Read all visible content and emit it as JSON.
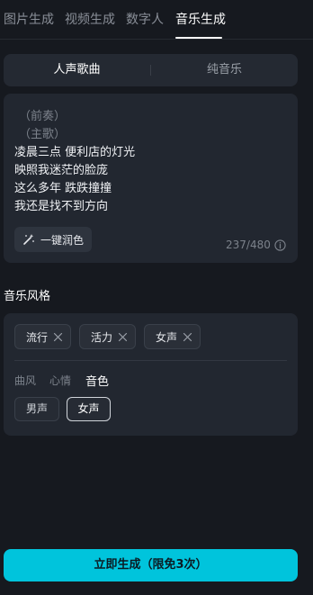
{
  "top_tabs": [
    {
      "label": "图片生成"
    },
    {
      "label": "视频生成"
    },
    {
      "label": "数字人"
    },
    {
      "label": "音乐生成",
      "active": true
    }
  ],
  "mode": {
    "vocal_label": "人声歌曲",
    "instrumental_label": "纯音乐",
    "selected": "人声歌曲"
  },
  "lyrics": {
    "lines": [
      "（前奏）",
      "（主歌）",
      "凌晨三点 便利店的灯光",
      "映照我迷茫的脸庞",
      "这么多年 跌跌撞撞",
      "我还是找不到方向"
    ],
    "polish_label": "一键润色",
    "counter": "237/480"
  },
  "style": {
    "title": "音乐风格",
    "chips": [
      {
        "label": "流行"
      },
      {
        "label": "活力"
      },
      {
        "label": "女声"
      }
    ],
    "sub_tabs": [
      {
        "label": "曲风"
      },
      {
        "label": "心情"
      },
      {
        "label": "音色",
        "active": true
      }
    ],
    "options": [
      {
        "label": "男声"
      },
      {
        "label": "女声",
        "selected": true
      }
    ]
  },
  "generate_label": "立即生成（限免3次）",
  "colors": {
    "background": "#16191f",
    "card": "#222730",
    "accent": "#00c4dc"
  }
}
